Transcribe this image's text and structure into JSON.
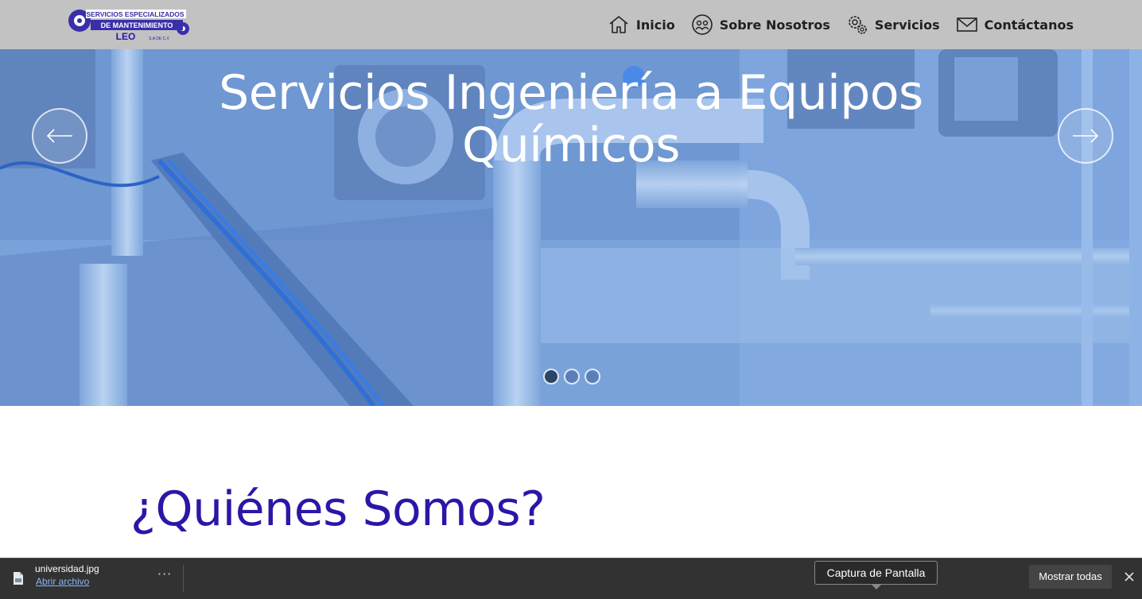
{
  "header": {
    "logo": {
      "line1": "SERVICIOS ESPECIALIZADOS",
      "line2": "DE MANTENIMIENTO",
      "line3": "LEO",
      "line4": "S.A DE C.V"
    },
    "nav": [
      {
        "label": "Inicio",
        "icon": "home-icon"
      },
      {
        "label": "Sobre Nosotros",
        "icon": "people-icon"
      },
      {
        "label": "Servicios",
        "icon": "gears-icon"
      },
      {
        "label": "Contáctanos",
        "icon": "envelope-icon"
      }
    ]
  },
  "hero": {
    "title_line1": "Servicios Ingeniería a Equipos",
    "title_line2": "Químicos",
    "slides": 3,
    "active_slide": 1
  },
  "section": {
    "title": "¿Quiénes Somos?"
  },
  "download_bar": {
    "file_name": "universidad.jpg",
    "open_link": "Abrir archivo",
    "more": "···",
    "tooltip": "Captura de Pantalla",
    "show_all": "Mostrar todas"
  },
  "colors": {
    "header_bg": "#c2c2c2",
    "hero_tint": "#7aa4dd",
    "section_title": "#2a17a8",
    "download_bar_bg": "#323232",
    "link": "#8ab4f8"
  }
}
